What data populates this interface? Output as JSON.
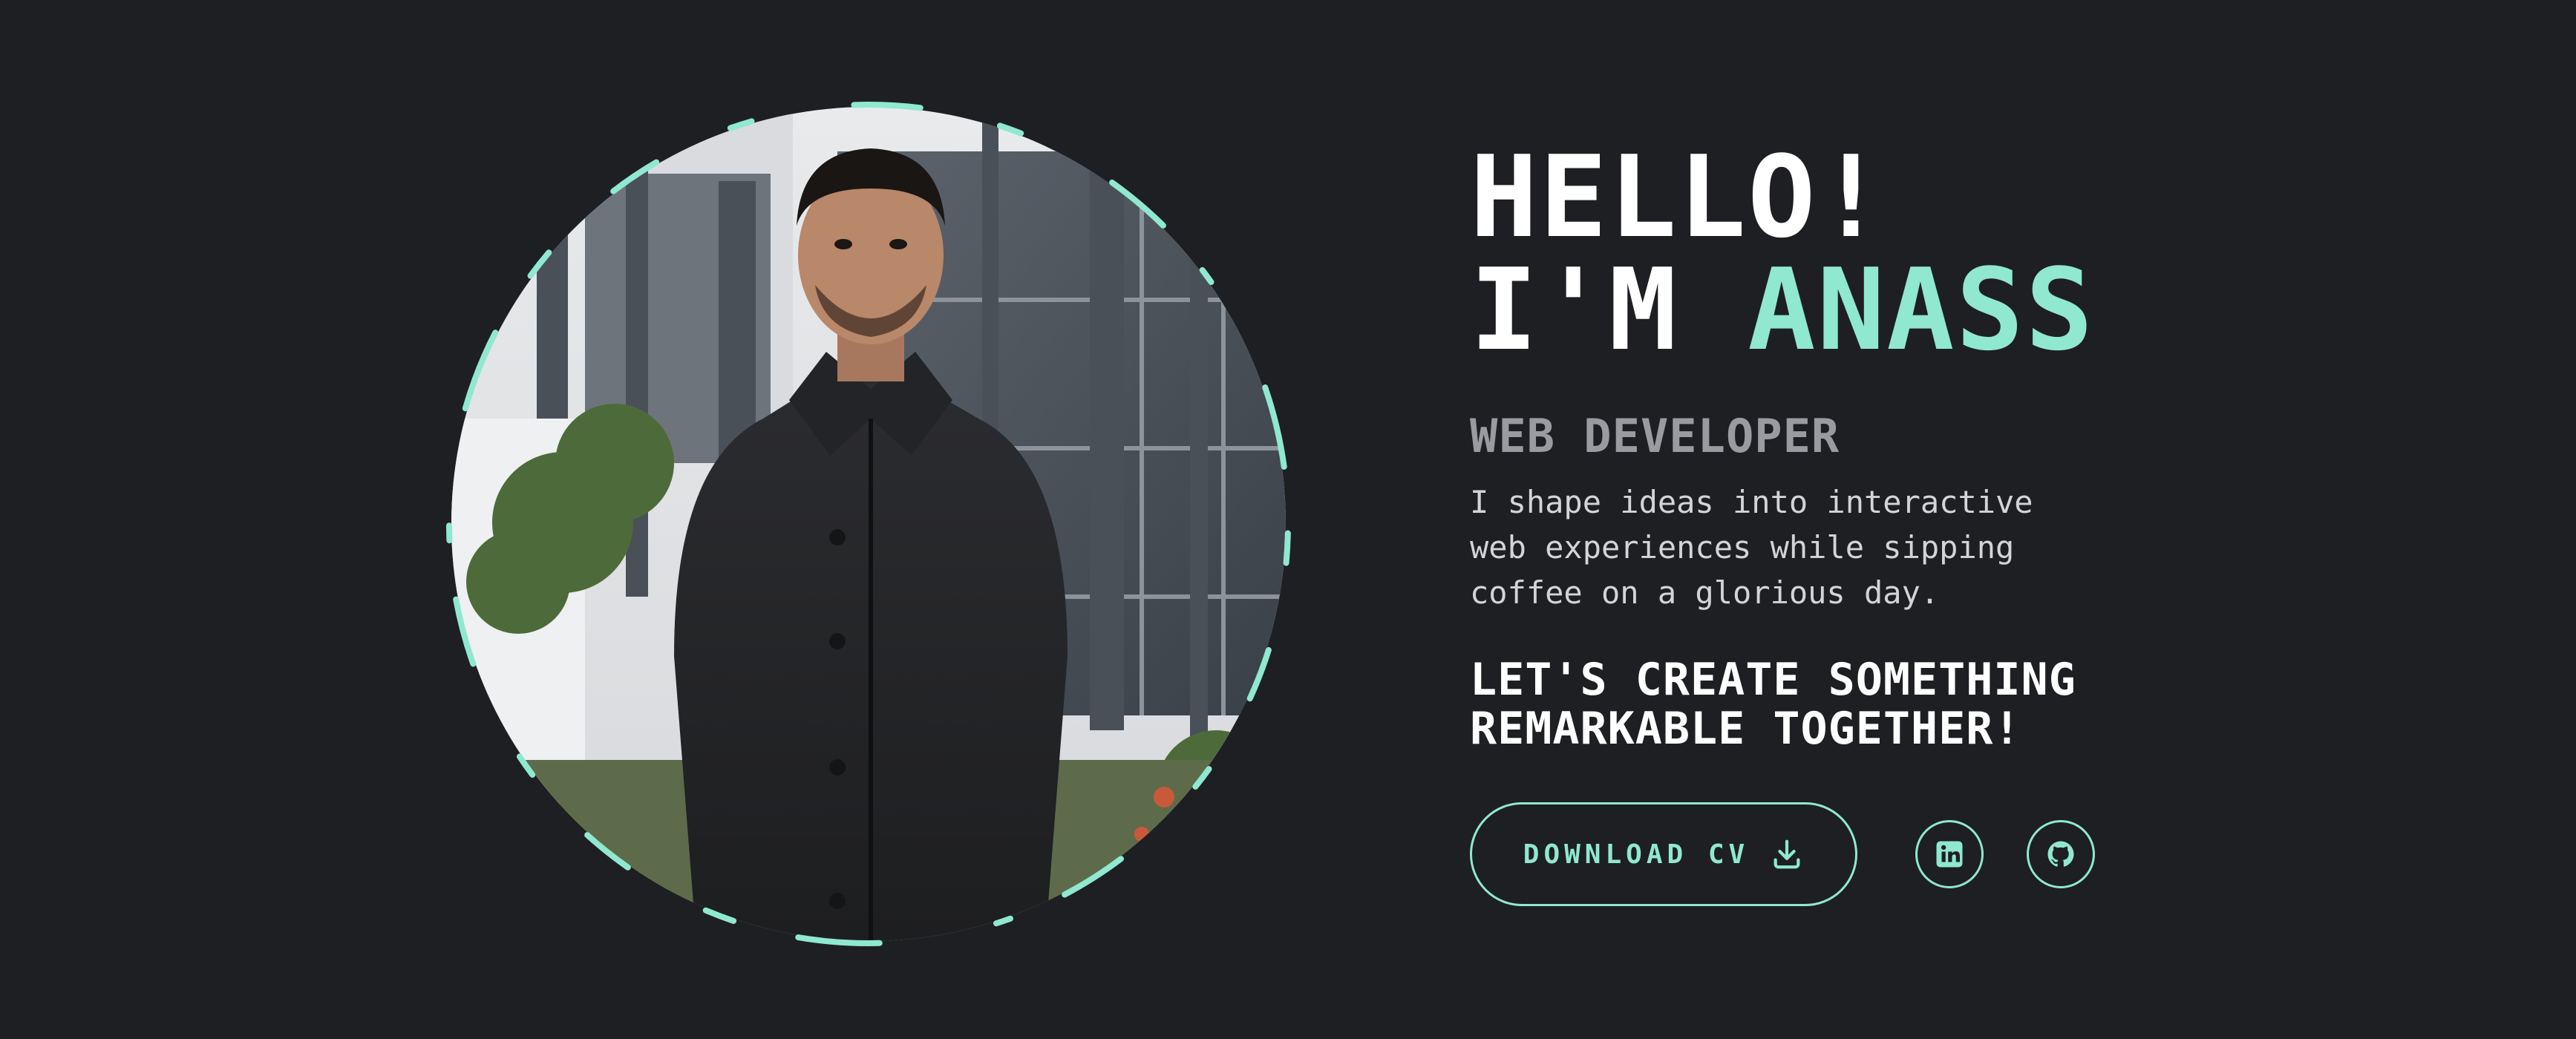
{
  "hero": {
    "greeting": "HELLO!",
    "intro_prefix": "I'M",
    "name": "ANASS",
    "role": "WEB DEVELOPER",
    "description": "I shape ideas into interactive web experiences while sipping coffee on a glorious day.",
    "cta_line_1": "LET'S CREATE SOMETHING",
    "cta_line_2": "REMARKABLE TOGETHER!"
  },
  "actions": {
    "download_cv_label": "DOWNLOAD CV",
    "download_icon": "download-icon",
    "social": [
      {
        "name": "LinkedIn",
        "icon": "linkedin-icon"
      },
      {
        "name": "GitHub",
        "icon": "github-icon"
      }
    ]
  },
  "theme": {
    "background": "#1e1f22",
    "accent": "#8fe8cf",
    "text_primary": "#ffffff",
    "text_secondary": "#9a9ba0",
    "text_body": "#d3d4d7"
  }
}
